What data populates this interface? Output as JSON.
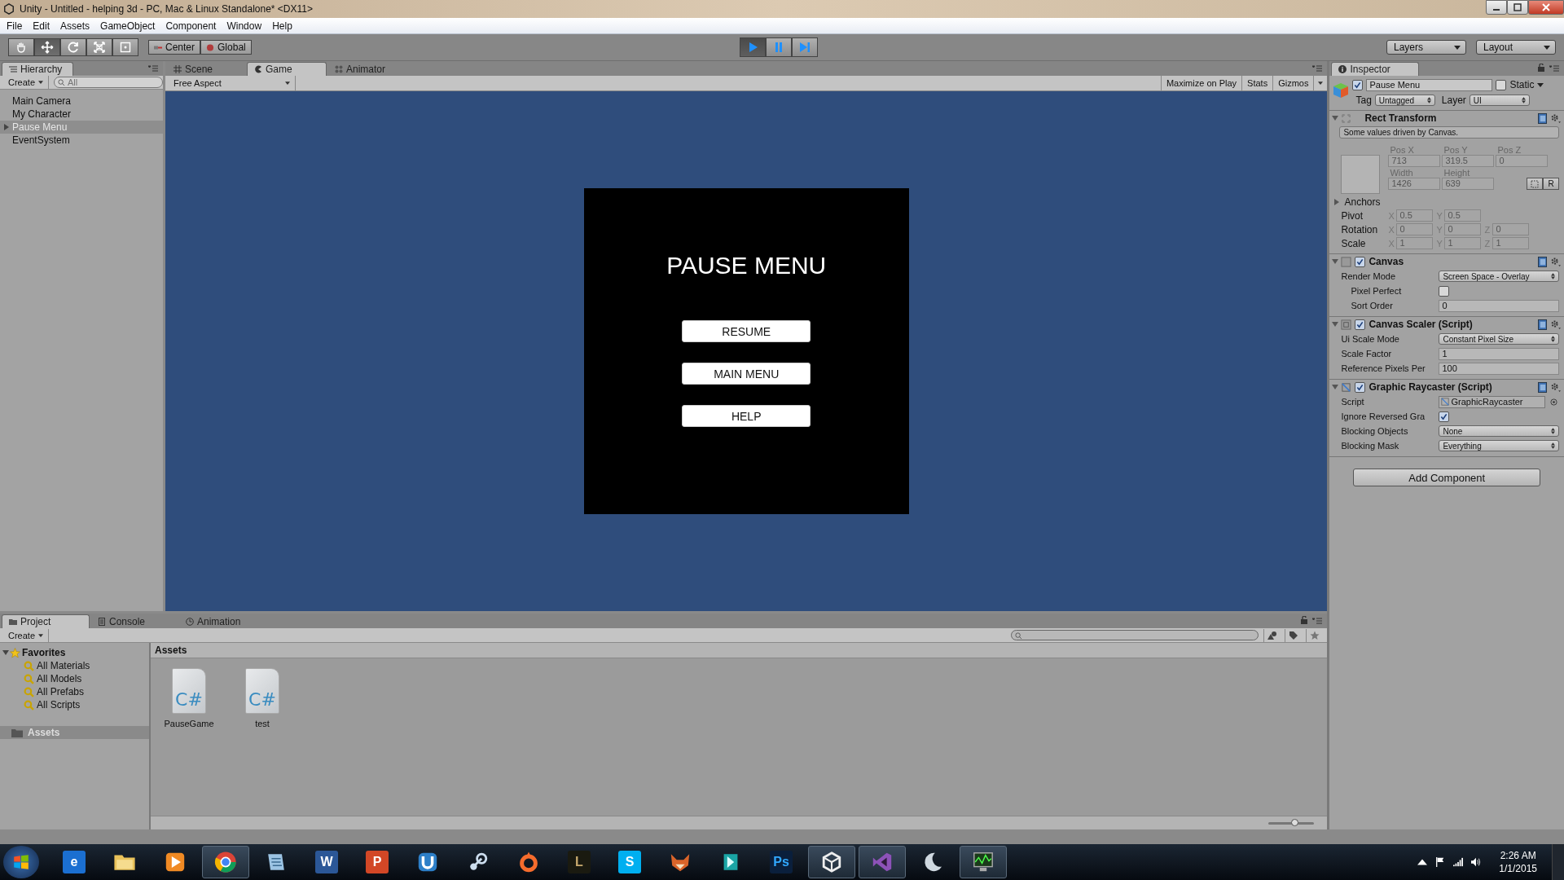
{
  "window": {
    "title": "Unity - Untitled - helping 3d - PC, Mac & Linux Standalone* <DX11>"
  },
  "menu": [
    "File",
    "Edit",
    "Assets",
    "GameObject",
    "Component",
    "Window",
    "Help"
  ],
  "toolbar": {
    "tools": [
      {
        "kind": "hand",
        "selected": false
      },
      {
        "kind": "move",
        "selected": true
      },
      {
        "kind": "rotate",
        "selected": false
      },
      {
        "kind": "scale",
        "selected": false
      },
      {
        "kind": "rect",
        "selected": false
      }
    ],
    "pivot": [
      {
        "kind": "center",
        "label": "Center"
      },
      {
        "kind": "global",
        "label": "Global"
      }
    ],
    "playback": [
      {
        "kind": "play",
        "selected": true
      },
      {
        "kind": "pause",
        "selected": false
      },
      {
        "kind": "step",
        "selected": false
      }
    ],
    "dropdowns": [
      "Layers",
      "Layout"
    ]
  },
  "hierarchy": {
    "tab": "Hierarchy",
    "create": "Create",
    "search_placeholder": "All",
    "items": [
      {
        "label": "Main Camera",
        "selected": false
      },
      {
        "label": "My Character",
        "selected": false
      },
      {
        "label": "Pause Menu",
        "selected": true,
        "expanded": false
      },
      {
        "label": "EventSystem",
        "selected": false
      }
    ]
  },
  "view_tabs": [
    {
      "label": "Scene",
      "kind": "scene",
      "selected": false
    },
    {
      "label": "Game",
      "kind": "game",
      "selected": true
    },
    {
      "label": "Animator",
      "kind": "animator",
      "selected": false
    }
  ],
  "game": {
    "aspect": "Free Aspect",
    "buttons": [
      "Maximize on Play",
      "Stats",
      "Gizmos"
    ],
    "menu": {
      "title": "PAUSE MENU",
      "buttons": [
        "RESUME",
        "MAIN MENU",
        "HELP"
      ]
    }
  },
  "inspector": {
    "tab": "Inspector",
    "object": {
      "active": true,
      "name": "Pause Menu",
      "static_label": "Static",
      "static": false,
      "tag_label": "Tag",
      "tag": "Untagged",
      "layer_label": "Layer",
      "layer": "UI"
    },
    "rect_transform": {
      "title": "Rect Transform",
      "expanded": true,
      "note": "Some values driven by Canvas.",
      "position": [
        {
          "label": "Pos X",
          "value": "713"
        },
        {
          "label": "Pos Y",
          "value": "319.5"
        },
        {
          "label": "Pos Z",
          "value": "0"
        }
      ],
      "size": [
        {
          "label": "Width",
          "value": "1426"
        },
        {
          "label": "Height",
          "value": "639"
        }
      ],
      "raw_button": "R",
      "anchors": {
        "label": "Anchors",
        "expanded": false
      },
      "vectors": [
        {
          "label": "Pivot",
          "fields": [
            {
              "axis": "X",
              "value": "0.5"
            },
            {
              "axis": "Y",
              "value": "0.5"
            }
          ]
        },
        {
          "label": "Rotation",
          "fields": [
            {
              "axis": "X",
              "value": "0"
            },
            {
              "axis": "Y",
              "value": "0"
            },
            {
              "axis": "Z",
              "value": "0"
            }
          ]
        },
        {
          "label": "Scale",
          "fields": [
            {
              "axis": "X",
              "value": "1"
            },
            {
              "axis": "Y",
              "value": "1"
            },
            {
              "axis": "Z",
              "value": "1"
            }
          ]
        }
      ]
    },
    "components": [
      {
        "title": "Canvas",
        "kind": "canvas",
        "expanded": true,
        "enabled": true,
        "rows": [
          {
            "kind": "dropdown",
            "label": "Render Mode",
            "value": "Screen Space - Overlay",
            "children": [
              {
                "kind": "checkbox",
                "label": "Pixel Perfect",
                "checked": false
              },
              {
                "kind": "field",
                "label": "Sort Order",
                "value": "0"
              }
            ]
          }
        ]
      },
      {
        "title": "Canvas Scaler (Script)",
        "kind": "scaler",
        "expanded": true,
        "enabled": true,
        "rows": [
          {
            "kind": "dropdown",
            "label": "Ui Scale Mode",
            "value": "Constant Pixel Size"
          },
          {
            "kind": "field",
            "label": "Scale Factor",
            "value": "1"
          },
          {
            "kind": "field",
            "label": "Reference Pixels Per",
            "value": "100"
          }
        ]
      },
      {
        "title": "Graphic Raycaster (Script)",
        "kind": "raycaster",
        "expanded": true,
        "enabled": true,
        "rows": [
          {
            "kind": "object",
            "label": "Script",
            "value": "GraphicRaycaster"
          },
          {
            "kind": "checkbox",
            "label": "Ignore Reversed Gra",
            "checked": true
          },
          {
            "kind": "dropdown",
            "label": "Blocking Objects",
            "value": "None"
          },
          {
            "kind": "dropdown",
            "label": "Blocking Mask",
            "value": "Everything"
          }
        ]
      }
    ],
    "add_component": "Add Component"
  },
  "project": {
    "tabs": [
      {
        "label": "Project",
        "kind": "project",
        "selected": true
      },
      {
        "label": "Console",
        "kind": "console",
        "selected": false
      },
      {
        "label": "Animation",
        "kind": "animation",
        "selected": false
      }
    ],
    "create": "Create",
    "favorites": {
      "label": "Favorites",
      "expanded": true,
      "children": [
        {
          "label": "All Materials"
        },
        {
          "label": "All Models"
        },
        {
          "label": "All Prefabs"
        },
        {
          "label": "All Scripts"
        }
      ]
    },
    "folders": [
      {
        "label": "Assets",
        "selected": true
      }
    ],
    "breadcrumb": "Assets",
    "files": [
      {
        "name": "PauseGame",
        "glyph": "C#"
      },
      {
        "name": "test",
        "glyph": "C#"
      }
    ],
    "zoom": {
      "level": 0.58
    }
  },
  "taskbar": {
    "apps": [
      {
        "kind": "ie",
        "glyph": "e",
        "active": false
      },
      {
        "kind": "folder",
        "active": false
      },
      {
        "kind": "media",
        "active": false
      },
      {
        "kind": "chrome",
        "active": true
      },
      {
        "kind": "notes",
        "active": false
      },
      {
        "kind": "word",
        "glyph": "W",
        "active": false
      },
      {
        "kind": "ppt",
        "glyph": "P",
        "active": false
      },
      {
        "kind": "uplay",
        "active": false
      },
      {
        "kind": "steam",
        "active": false
      },
      {
        "kind": "origin",
        "active": false
      },
      {
        "kind": "lol",
        "glyph": "L",
        "active": false
      },
      {
        "kind": "skype",
        "glyph": "S",
        "active": false
      },
      {
        "kind": "fox",
        "active": false
      },
      {
        "kind": "maya",
        "active": false
      },
      {
        "kind": "ps",
        "glyph": "Ps",
        "active": false
      },
      {
        "kind": "unity",
        "active": true
      },
      {
        "kind": "vs",
        "active": true
      },
      {
        "kind": "moon",
        "active": false
      },
      {
        "kind": "monitor",
        "active": true
      }
    ],
    "time": "2:26 AM",
    "date": "1/1/2015"
  }
}
